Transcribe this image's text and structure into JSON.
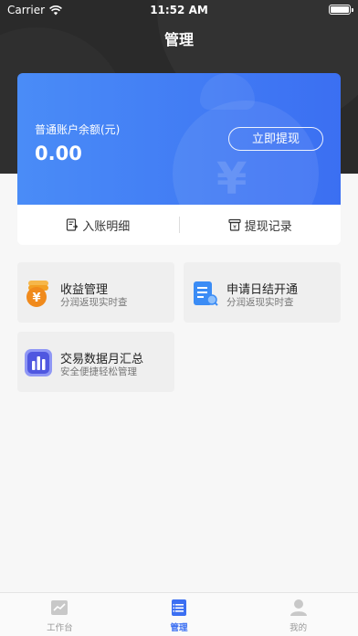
{
  "status_bar": {
    "carrier": "Carrier",
    "time": "11:52 AM"
  },
  "nav": {
    "title": "管理"
  },
  "balance": {
    "label": "普通账户余额(元)",
    "amount": "0.00",
    "withdraw_button": "立即提现"
  },
  "links": [
    {
      "label": "入账明细",
      "icon": "receipt-icon"
    },
    {
      "label": "提现记录",
      "icon": "withdraw-record-icon"
    }
  ],
  "features": [
    {
      "title": "收益管理",
      "subtitle": "分润返现实时查",
      "icon": "coins-icon",
      "color": "#f3a024"
    },
    {
      "title": "申请日结开通",
      "subtitle": "分润返现实时查",
      "icon": "document-search-icon",
      "color": "#3b8cf5"
    },
    {
      "title": "交易数据月汇总",
      "subtitle": "安全便捷轻松管理",
      "icon": "bar-chart-icon",
      "color": "#5a63e8"
    }
  ],
  "tabbar": [
    {
      "label": "工作台",
      "icon": "workbench-icon",
      "active": false
    },
    {
      "label": "管理",
      "icon": "manage-icon",
      "active": true
    },
    {
      "label": "我的",
      "icon": "profile-icon",
      "active": false
    }
  ],
  "colors": {
    "accent": "#3b6ff2",
    "header_bg": "#2a2a2a"
  }
}
